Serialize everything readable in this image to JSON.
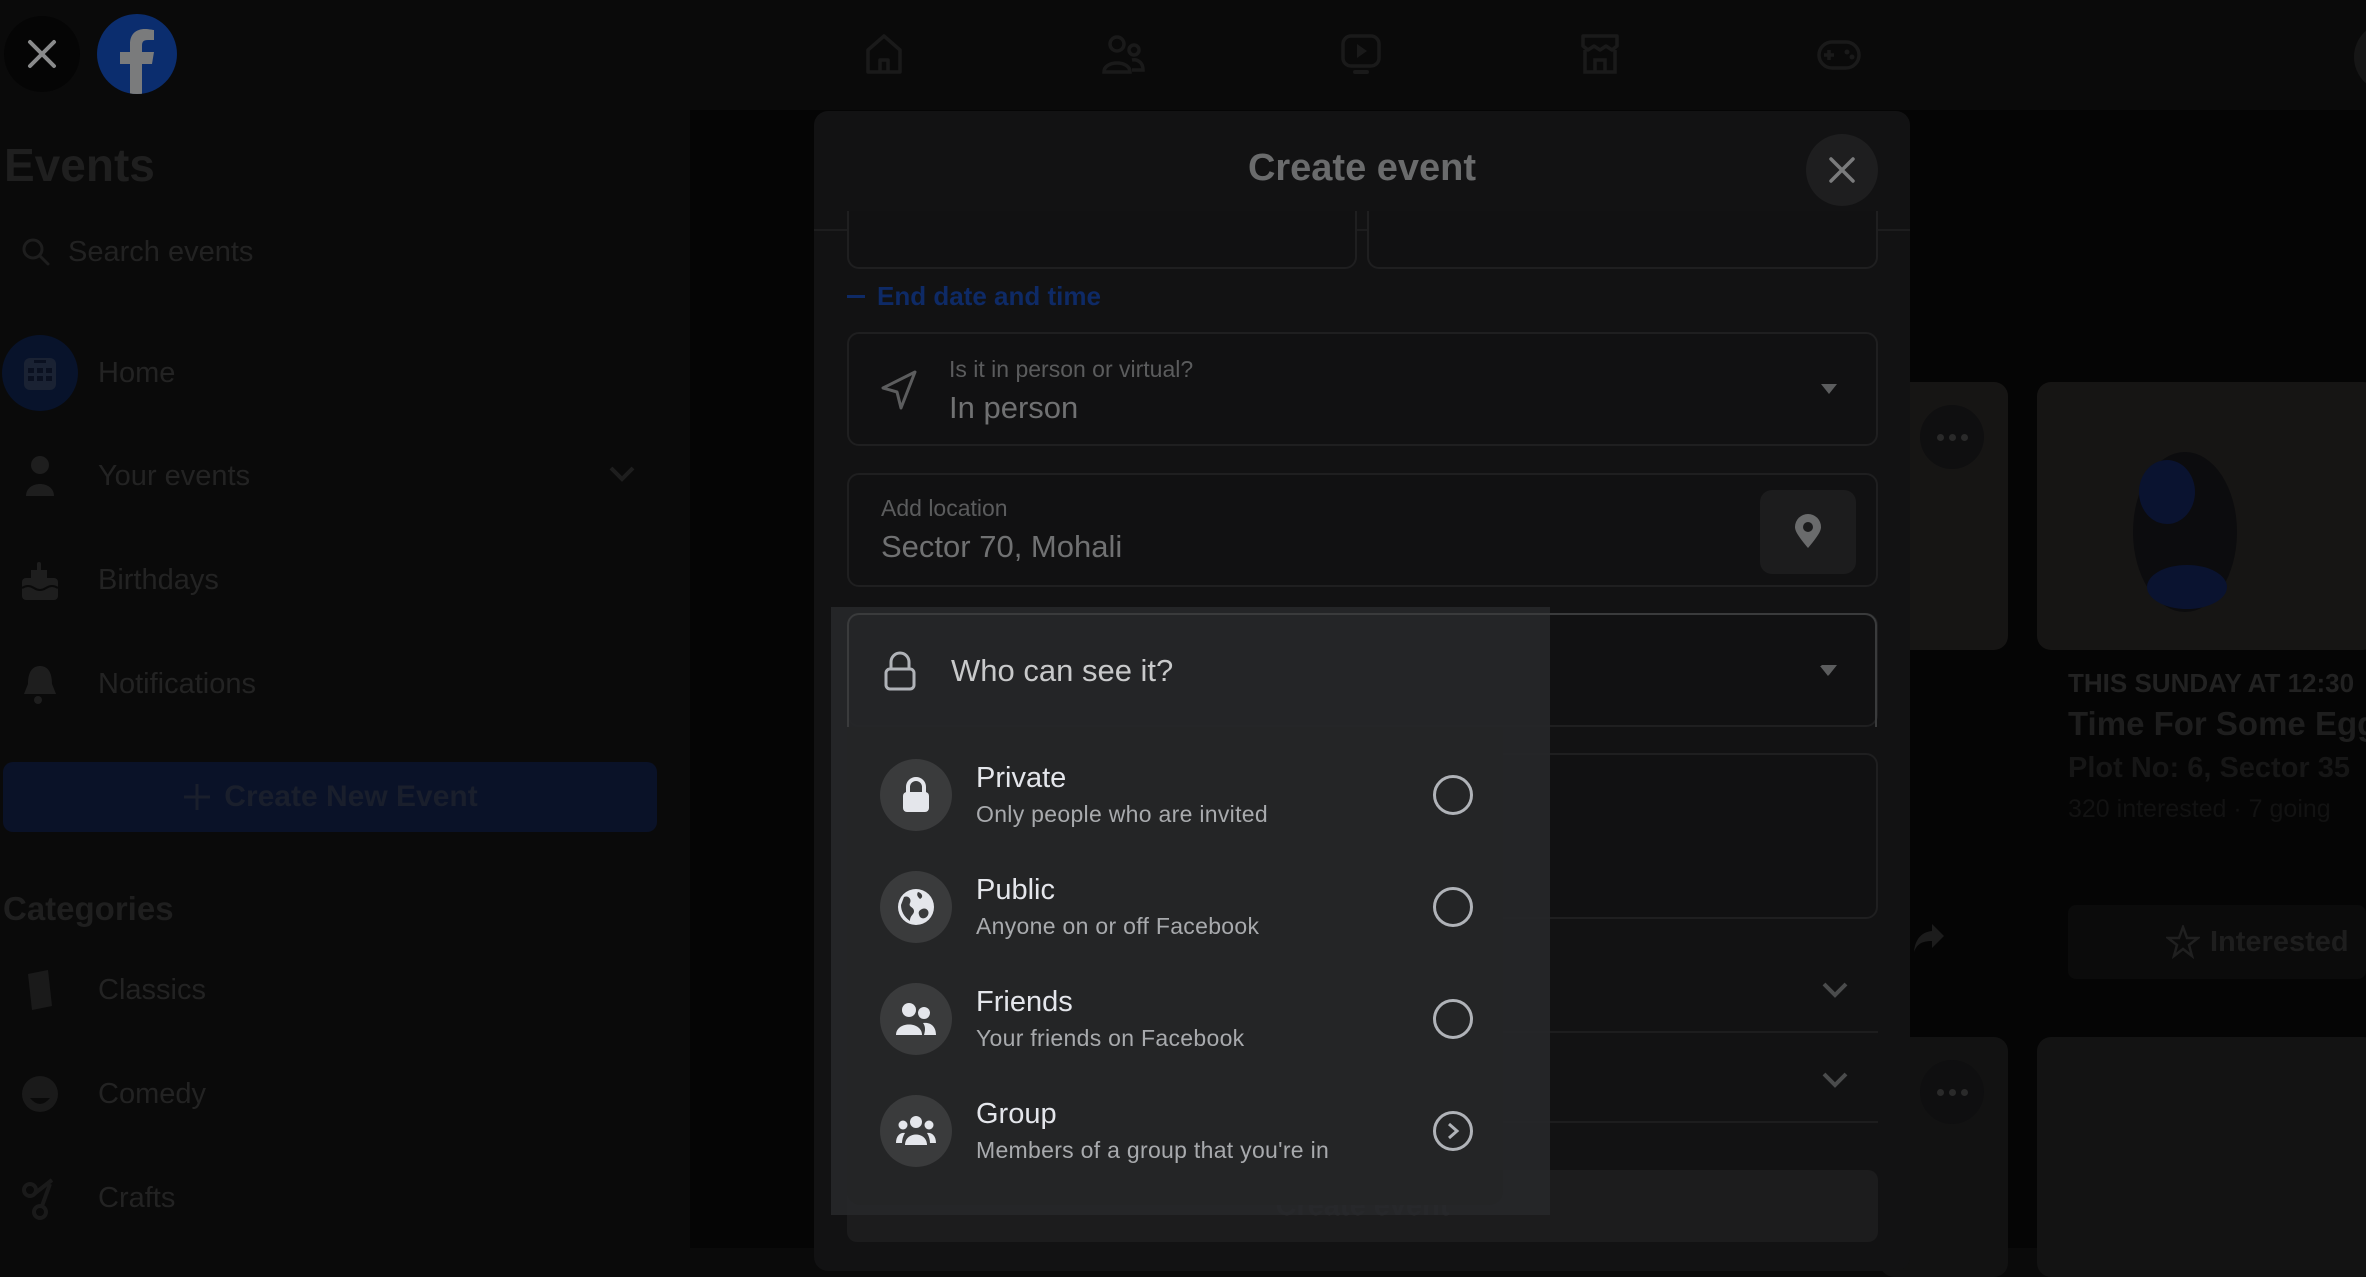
{
  "topbar": {
    "close_icon": "close-icon",
    "logo": "facebook-logo",
    "nav": [
      {
        "name": "home",
        "icon": "home-icon"
      },
      {
        "name": "friends",
        "icon": "friends-icon"
      },
      {
        "name": "watch",
        "icon": "video-icon"
      },
      {
        "name": "marketplace",
        "icon": "marketplace-icon"
      },
      {
        "name": "gaming",
        "icon": "gaming-icon"
      }
    ]
  },
  "sidebar": {
    "title": "Events",
    "search_placeholder": "Search events",
    "items": [
      {
        "label": "Home",
        "icon": "calendar-icon",
        "active": true
      },
      {
        "label": "Your events",
        "icon": "person-icon",
        "expandable": true
      },
      {
        "label": "Birthdays",
        "icon": "cake-icon"
      },
      {
        "label": "Notifications",
        "icon": "bell-icon"
      }
    ],
    "create_button": "Create New Event",
    "categories_title": "Categories",
    "categories": [
      {
        "label": "Classics",
        "icon": "book-icon"
      },
      {
        "label": "Comedy",
        "icon": "laugh-icon"
      },
      {
        "label": "Crafts",
        "icon": "scissors-icon"
      }
    ]
  },
  "feed": {
    "card": {
      "when": "THIS SUNDAY AT 12:30",
      "title": "Time For Some Egg",
      "location": "Plot No: 6, Sector 35",
      "stats": "320 interested · 7 going",
      "interested_label": "Interested"
    }
  },
  "modal": {
    "title": "Create event",
    "end_date_toggle": "End date and time",
    "event_type": {
      "label": "Is it in person or virtual?",
      "value": "In person"
    },
    "location": {
      "label": "Add location",
      "value": "Sector 70, Mohali"
    },
    "visibility": {
      "placeholder": "Who can see it?",
      "options": [
        {
          "title": "Private",
          "subtitle": "Only people who are invited",
          "icon": "lock-icon",
          "control": "radio",
          "selected": false
        },
        {
          "title": "Public",
          "subtitle": "Anyone on or off Facebook",
          "icon": "globe-icon",
          "control": "radio",
          "selected": false
        },
        {
          "title": "Friends",
          "subtitle": "Your friends on Facebook",
          "icon": "friends-icon",
          "control": "radio",
          "selected": false
        },
        {
          "title": "Group",
          "subtitle": "Members of a group that you're in",
          "icon": "group-icon",
          "control": "chevron",
          "selected": false
        }
      ]
    },
    "submit_label": "Create event"
  },
  "colors": {
    "accent": "#1877f2",
    "menu_bg": "#242526",
    "text_primary": "#e4e6eb",
    "text_secondary": "#b0b3b8"
  }
}
